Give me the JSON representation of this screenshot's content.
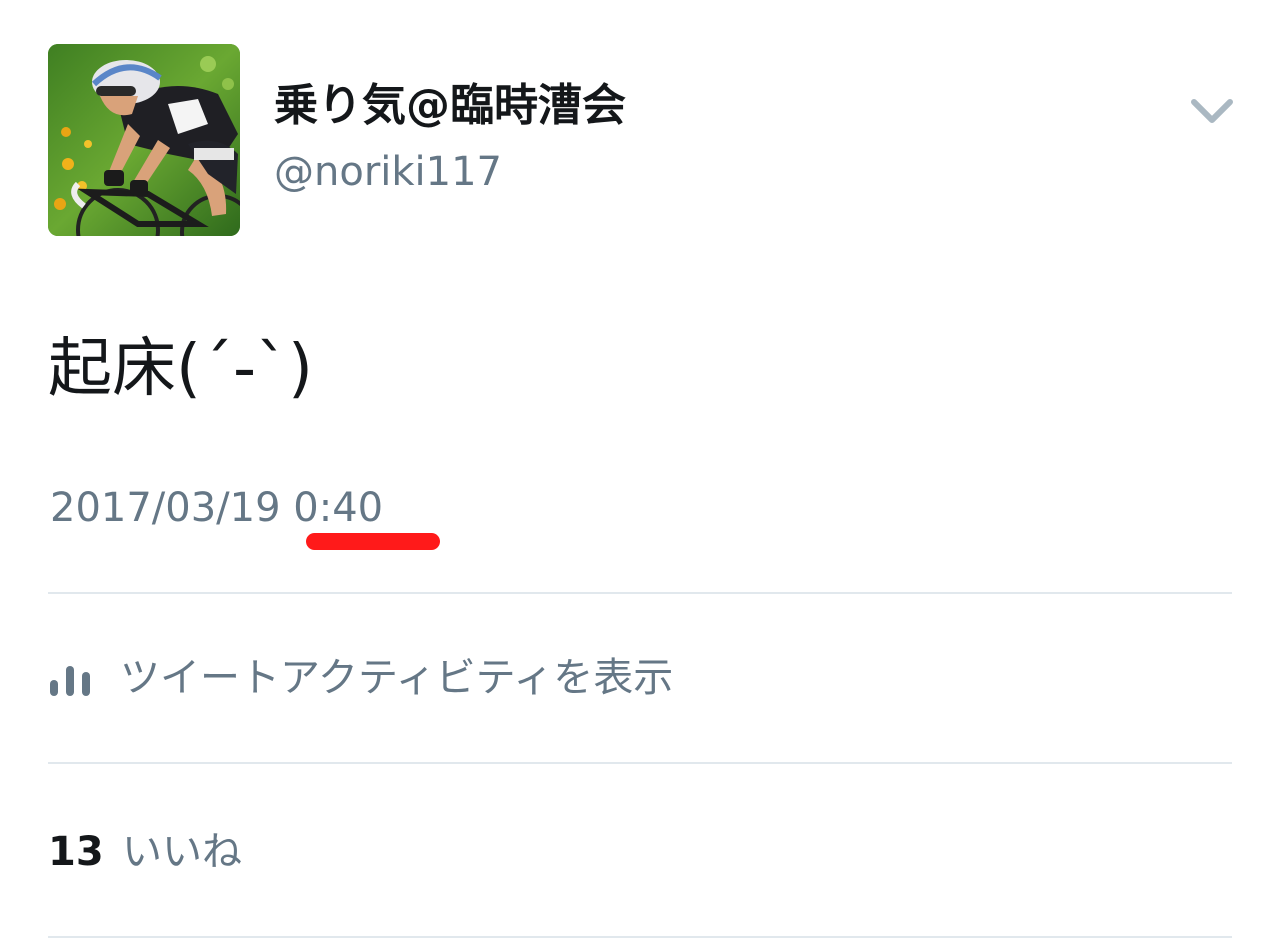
{
  "user": {
    "display_name": "乗り気@臨時漕会",
    "handle": "@noriki117",
    "avatar": "cyclist-photo"
  },
  "tweet": {
    "text": "起床(´-`)",
    "date": "2017/03/19",
    "time": "0:40"
  },
  "menu": {
    "icon": "chevron-down-icon"
  },
  "activity": {
    "icon": "bar-chart-icon",
    "label": "ツイートアクティビティを表示"
  },
  "likes": {
    "count": "13",
    "label": "いいね"
  },
  "colors": {
    "text_primary": "#14171a",
    "text_secondary": "#657786",
    "divider": "#e1e8ed",
    "highlight_mark": "#ff1a1a"
  }
}
